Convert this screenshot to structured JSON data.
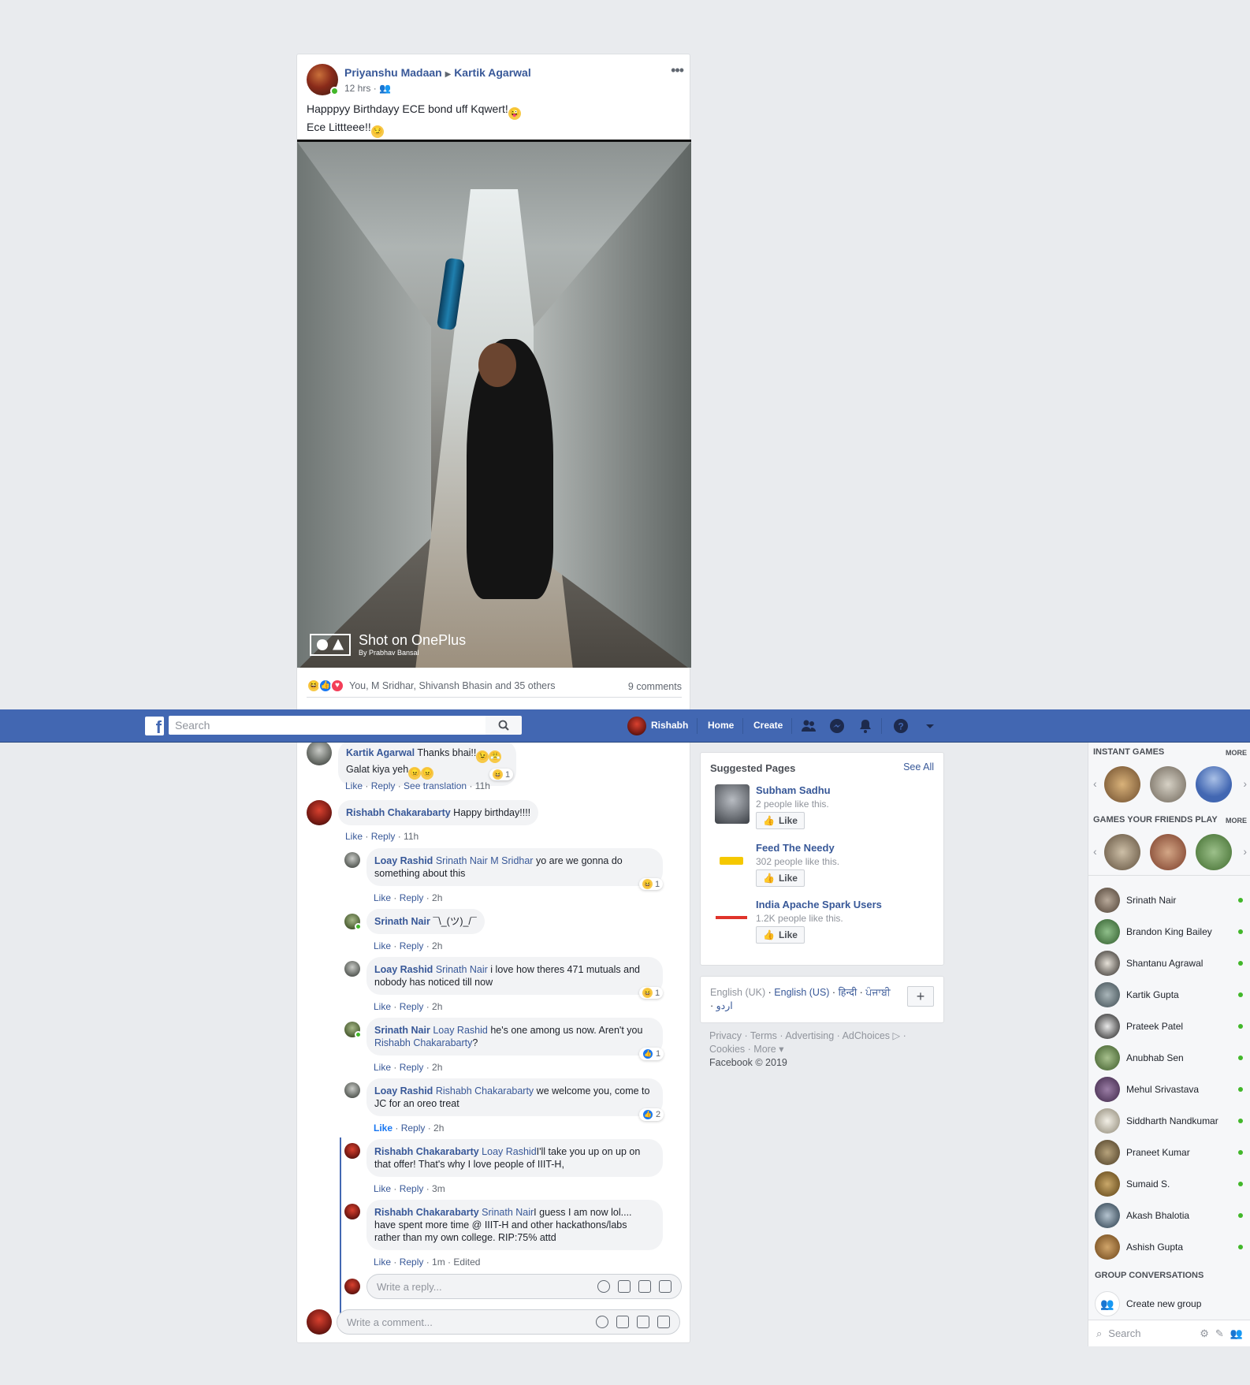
{
  "post": {
    "author": "Priyanshu Madaan",
    "target": "Kartik Agarwal",
    "time": "12 hrs",
    "text_line1": "Happpyy Birthdayy ECE bond uff Kqwert!",
    "text_line2": "Ece Littteee!!",
    "watermark_title": "Shot on OnePlus",
    "watermark_sub": "By Prabhav Bansal",
    "reactions_text": "You, M Sridhar, Shivansh Bhasin and 35 others",
    "comments_count": "9 comments"
  },
  "topbar": {
    "search_placeholder": "Search",
    "user": "Rishabh",
    "home": "Home",
    "create": "Create"
  },
  "comments": [
    {
      "author": "Kartik Agarwal",
      "text": "Thanks bhai!!",
      "text2": "Galat kiya yeh",
      "like": "Like",
      "reply": "Reply",
      "translate": "See translation",
      "time": "11h",
      "reactions": "1"
    },
    {
      "author": "Rishabh Chakarabarty",
      "text": "Happy birthday!!!!",
      "like": "Like",
      "reply": "Reply",
      "time": "11h"
    }
  ],
  "replies": [
    {
      "author": "Loay Rashid",
      "mention": "Srinath Nair M Sridhar",
      "text": " yo are we gonna do something about this",
      "like": "Like",
      "reply": "Reply",
      "time": "2h",
      "reactions": "1"
    },
    {
      "author": "Srinath Nair",
      "mention": "",
      "text": " ¯\\_(ツ)_/¯",
      "like": "Like",
      "reply": "Reply",
      "time": "2h"
    },
    {
      "author": "Loay Rashid",
      "mention": "Srinath Nair",
      "text": " i love how theres 471 mutuals and nobody has noticed till now",
      "like": "Like",
      "reply": "Reply",
      "time": "2h",
      "reactions": "1"
    },
    {
      "author": "Srinath Nair",
      "mention": "Loay Rashid",
      "text": " he's one among us now. Aren't you ",
      "mention2": "Rishabh Chakarabarty",
      "text2": "?",
      "like": "Like",
      "reply": "Reply",
      "time": "2h",
      "reactions": "1"
    },
    {
      "author": "Loay Rashid",
      "mention": "Rishabh Chakarabarty",
      "text": " we welcome you, come to JC for an oreo treat",
      "like": "Like",
      "reply": "Reply",
      "time": "2h",
      "reactions": "2"
    },
    {
      "author": "Rishabh Chakarabarty",
      "mention": "Loay Rashid",
      "text": "I'll take you up on up on that offer! That's why I love people of IIIT-H,",
      "like": "Like",
      "reply": "Reply",
      "time": "3m"
    },
    {
      "author": "Rishabh Chakarabarty",
      "mention": "Srinath Nair",
      "text": "I guess I am now lol.... have spent more time @ IIIT-H and other hackathons/labs rather than my own college. RIP:75% attd",
      "like": "Like",
      "reply": "Reply",
      "time": "1m",
      "edited": "Edited"
    }
  ],
  "reply_input_placeholder": "Write a reply...",
  "comment_input_placeholder": "Write a comment...",
  "suggested": {
    "title": "Suggested Pages",
    "see_all": "See All",
    "pages": [
      {
        "name": "Subham Sadhu",
        "likes": "2 people like this.",
        "button": "Like"
      },
      {
        "name": "Feed The Needy",
        "likes": "302 people like this.",
        "button": "Like"
      },
      {
        "name": "India Apache Spark Users",
        "likes": "1.2K people like this.",
        "button": "Like"
      }
    ]
  },
  "languages": {
    "current": "English (UK)",
    "options": [
      "English (US)",
      "हिन्दी",
      "ਪੰਜਾਬੀ"
    ],
    "extra": "اردو",
    "add": "+"
  },
  "footer": {
    "privacy": "Privacy",
    "terms": "Terms",
    "advertising": "Advertising",
    "adchoices": "AdChoices",
    "cookies": "Cookies",
    "more": "More",
    "copyright": "Facebook © 2019"
  },
  "chat": {
    "instant_games": "INSTANT GAMES",
    "games_friends": "GAMES YOUR FRIENDS PLAY",
    "more": "MORE",
    "contacts": [
      "Srinath Nair",
      "Brandon King Bailey",
      "Shantanu Agrawal",
      "Kartik Gupta",
      "Prateek Patel",
      "Anubhab Sen",
      "Mehul Srivastava",
      "Siddharth Nandkumar",
      "Praneet Kumar",
      "Sumaid S.",
      "Akash Bhalotia",
      "Ashish Gupta"
    ],
    "group_conversations": "GROUP CONVERSATIONS",
    "create_group": "Create new group",
    "search_placeholder": "Search"
  },
  "colors": {
    "brand": "#4267b2",
    "link": "#385898",
    "online": "#42b72a"
  }
}
